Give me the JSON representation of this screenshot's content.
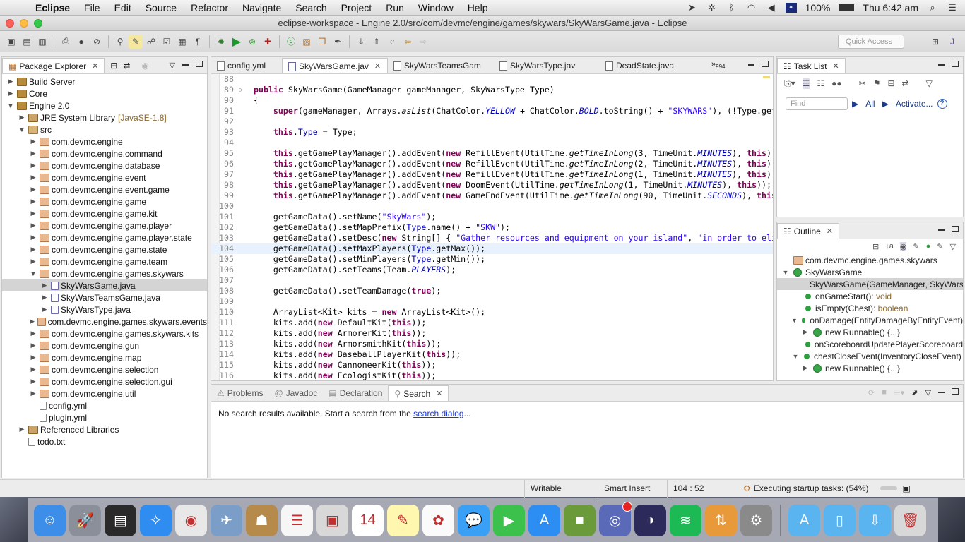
{
  "menubar": {
    "app_name": "Eclipse",
    "items": [
      "File",
      "Edit",
      "Source",
      "Refactor",
      "Navigate",
      "Search",
      "Project",
      "Run",
      "Window",
      "Help"
    ],
    "battery": "100%",
    "clock": "Thu 6:42 am"
  },
  "window": {
    "title": "eclipse-workspace - Engine 2.0/src/com/devmc/engine/games/skywars/SkyWarsGame.java - Eclipse",
    "quick_access_placeholder": "Quick Access"
  },
  "package_explorer": {
    "tab_label": "Package Explorer",
    "rows": [
      {
        "depth": 0,
        "twisty": "▶",
        "icon": "proj",
        "label": "Build Server",
        "deco": ""
      },
      {
        "depth": 0,
        "twisty": "▶",
        "icon": "proj",
        "label": "Core",
        "deco": ""
      },
      {
        "depth": 0,
        "twisty": "▼",
        "icon": "proj",
        "label": "Engine 2.0",
        "deco": ""
      },
      {
        "depth": 1,
        "twisty": "▶",
        "icon": "lib",
        "label": "JRE System Library",
        "deco": "[JavaSE-1.8]"
      },
      {
        "depth": 1,
        "twisty": "▼",
        "icon": "src",
        "label": "src",
        "deco": ""
      },
      {
        "depth": 2,
        "twisty": "▶",
        "icon": "pkg",
        "label": "com.devmc.engine",
        "deco": ""
      },
      {
        "depth": 2,
        "twisty": "▶",
        "icon": "pkg",
        "label": "com.devmc.engine.command",
        "deco": ""
      },
      {
        "depth": 2,
        "twisty": "▶",
        "icon": "pkg",
        "label": "com.devmc.engine.database",
        "deco": ""
      },
      {
        "depth": 2,
        "twisty": "▶",
        "icon": "pkg",
        "label": "com.devmc.engine.event",
        "deco": ""
      },
      {
        "depth": 2,
        "twisty": "▶",
        "icon": "pkg",
        "label": "com.devmc.engine.event.game",
        "deco": ""
      },
      {
        "depth": 2,
        "twisty": "▶",
        "icon": "pkg",
        "label": "com.devmc.engine.game",
        "deco": ""
      },
      {
        "depth": 2,
        "twisty": "▶",
        "icon": "pkg",
        "label": "com.devmc.engine.game.kit",
        "deco": ""
      },
      {
        "depth": 2,
        "twisty": "▶",
        "icon": "pkg",
        "label": "com.devmc.engine.game.player",
        "deco": ""
      },
      {
        "depth": 2,
        "twisty": "▶",
        "icon": "pkg",
        "label": "com.devmc.engine.game.player.state",
        "deco": ""
      },
      {
        "depth": 2,
        "twisty": "▶",
        "icon": "pkg",
        "label": "com.devmc.engine.game.state",
        "deco": ""
      },
      {
        "depth": 2,
        "twisty": "▶",
        "icon": "pkg",
        "label": "com.devmc.engine.game.team",
        "deco": ""
      },
      {
        "depth": 2,
        "twisty": "▼",
        "icon": "pkg",
        "label": "com.devmc.engine.games.skywars",
        "deco": ""
      },
      {
        "depth": 3,
        "twisty": "▶",
        "icon": "java",
        "label": "SkyWarsGame.java",
        "deco": "",
        "selected": true
      },
      {
        "depth": 3,
        "twisty": "▶",
        "icon": "java",
        "label": "SkyWarsTeamsGame.java",
        "deco": ""
      },
      {
        "depth": 3,
        "twisty": "▶",
        "icon": "java",
        "label": "SkyWarsType.java",
        "deco": ""
      },
      {
        "depth": 2,
        "twisty": "▶",
        "icon": "pkg",
        "label": "com.devmc.engine.games.skywars.events",
        "deco": ""
      },
      {
        "depth": 2,
        "twisty": "▶",
        "icon": "pkg",
        "label": "com.devmc.engine.games.skywars.kits",
        "deco": ""
      },
      {
        "depth": 2,
        "twisty": "▶",
        "icon": "pkg",
        "label": "com.devmc.engine.gun",
        "deco": ""
      },
      {
        "depth": 2,
        "twisty": "▶",
        "icon": "pkg",
        "label": "com.devmc.engine.map",
        "deco": ""
      },
      {
        "depth": 2,
        "twisty": "▶",
        "icon": "pkg",
        "label": "com.devmc.engine.selection",
        "deco": ""
      },
      {
        "depth": 2,
        "twisty": "▶",
        "icon": "pkg",
        "label": "com.devmc.engine.selection.gui",
        "deco": ""
      },
      {
        "depth": 2,
        "twisty": "▶",
        "icon": "pkg",
        "label": "com.devmc.engine.util",
        "deco": ""
      },
      {
        "depth": 2,
        "twisty": "",
        "icon": "file",
        "label": "config.yml",
        "deco": ""
      },
      {
        "depth": 2,
        "twisty": "",
        "icon": "file",
        "label": "plugin.yml",
        "deco": ""
      },
      {
        "depth": 1,
        "twisty": "▶",
        "icon": "lib",
        "label": "Referenced Libraries",
        "deco": ""
      },
      {
        "depth": 1,
        "twisty": "",
        "icon": "file",
        "label": "todo.txt",
        "deco": ""
      }
    ]
  },
  "editor": {
    "tabs": [
      {
        "label": "config.yml",
        "active": false,
        "kind": "file"
      },
      {
        "label": "SkyWarsGame.jav",
        "active": true,
        "kind": "java"
      },
      {
        "label": "SkyWarsTeamsGam",
        "active": false,
        "kind": "java"
      },
      {
        "label": "SkyWarsType.jav",
        "active": false,
        "kind": "java"
      },
      {
        "label": "DeadState.java",
        "active": false,
        "kind": "java"
      }
    ],
    "overflow_label": "»",
    "overflow_count": "994",
    "current_line": 104,
    "lines": [
      {
        "n": "88",
        "html": ""
      },
      {
        "n": "89",
        "fold": "⊖",
        "html": "<span class='kw'>public</span> SkyWarsGame(GameManager gameManager, SkyWarsType Type)"
      },
      {
        "n": "90",
        "html": "{"
      },
      {
        "n": "91",
        "html": "    <span class='kw'>super</span>(gameManager, Arrays.<span class='ital'>asList</span>(ChatColor.<span class='stat'>YELLOW</span> + ChatColor.<span class='stat'>BOLD</span>.toString() + <span class='str'>\"SKYWARS\"</span>), (!Type.getN"
      },
      {
        "n": "92",
        "html": ""
      },
      {
        "n": "93",
        "html": "    <span class='kw'>this</span>.<span class='fld'>Type</span> = Type;"
      },
      {
        "n": "94",
        "html": ""
      },
      {
        "n": "95",
        "html": "    <span class='kw'>this</span>.getGamePlayManager().addEvent(<span class='kw'>new</span> RefillEvent(UtilTime.<span class='ital'>getTimeInLong</span>(3, TimeUnit.<span class='stat'>MINUTES</span>), <span class='kw'>this</span>));"
      },
      {
        "n": "96",
        "html": "    <span class='kw'>this</span>.getGamePlayManager().addEvent(<span class='kw'>new</span> RefillEvent(UtilTime.<span class='ital'>getTimeInLong</span>(2, TimeUnit.<span class='stat'>MINUTES</span>), <span class='kw'>this</span>));"
      },
      {
        "n": "97",
        "html": "    <span class='kw'>this</span>.getGamePlayManager().addEvent(<span class='kw'>new</span> RefillEvent(UtilTime.<span class='ital'>getTimeInLong</span>(1, TimeUnit.<span class='stat'>MINUTES</span>), <span class='kw'>this</span>));"
      },
      {
        "n": "98",
        "html": "    <span class='kw'>this</span>.getGamePlayManager().addEvent(<span class='kw'>new</span> DoomEvent(UtilTime.<span class='ital'>getTimeInLong</span>(1, TimeUnit.<span class='stat'>MINUTES</span>), <span class='kw'>this</span>));"
      },
      {
        "n": "99",
        "html": "    <span class='kw'>this</span>.getGamePlayManager().addEvent(<span class='kw'>new</span> GameEndEvent(UtilTime.<span class='ital'>getTimeInLong</span>(90, TimeUnit.<span class='stat'>SECONDS</span>), <span class='kw'>this</span>"
      },
      {
        "n": "100",
        "html": ""
      },
      {
        "n": "101",
        "html": "    getGameData().setName(<span class='str'>\"SkyWars\"</span>);"
      },
      {
        "n": "102",
        "html": "    getGameData().setMapPrefix(<span class='fld'>Type</span>.name() + <span class='str'>\"SKW\"</span>);"
      },
      {
        "n": "103",
        "html": "    getGameData().setDesc(<span class='kw'>new</span> String[] { <span class='str'>\"Gather resources and equipment on your island\"</span>, <span class='str'>\"in order to elim</span>"
      },
      {
        "n": "104",
        "html": "    getGameData().setMaxPlayers(<span class='fld'>Type</span>.getMax());"
      },
      {
        "n": "105",
        "html": "    getGameData().setMinPlayers(<span class='fld'>Type</span>.getMin());"
      },
      {
        "n": "106",
        "html": "    getGameData().setTeams(Team.<span class='stat'>PLAYERS</span>);"
      },
      {
        "n": "107",
        "html": ""
      },
      {
        "n": "108",
        "html": "    getGameData().setTeamDamage(<span class='kw'>true</span>);"
      },
      {
        "n": "109",
        "html": ""
      },
      {
        "n": "110",
        "html": "    ArrayList&lt;Kit&gt; kits = <span class='kw'>new</span> ArrayList&lt;Kit&gt;();"
      },
      {
        "n": "111",
        "html": "    kits.add(<span class='kw'>new</span> DefaultKit(<span class='kw'>this</span>));"
      },
      {
        "n": "112",
        "html": "    kits.add(<span class='kw'>new</span> ArmorerKit(<span class='kw'>this</span>));"
      },
      {
        "n": "113",
        "html": "    kits.add(<span class='kw'>new</span> ArmorsmithKit(<span class='kw'>this</span>));"
      },
      {
        "n": "114",
        "html": "    kits.add(<span class='kw'>new</span> BaseballPlayerKit(<span class='kw'>this</span>));"
      },
      {
        "n": "115",
        "html": "    kits.add(<span class='kw'>new</span> CannoneerKit(<span class='kw'>this</span>));"
      },
      {
        "n": "116",
        "html": "    kits.add(<span class='kw'>new</span> EcologistKit(<span class='kw'>this</span>));"
      }
    ]
  },
  "task_list": {
    "tab_label": "Task List",
    "find_placeholder": "Find",
    "all_label": "All",
    "activate_label": "Activate..."
  },
  "outline": {
    "tab_label": "Outline",
    "rows": [
      {
        "indent": 1,
        "kind": "pkg",
        "label": "com.devmc.engine.games.skywars",
        "ret": ""
      },
      {
        "indent": 0,
        "twisty": "▼",
        "kind": "class",
        "label": "SkyWarsGame",
        "ret": ""
      },
      {
        "indent": 2,
        "kind": "method",
        "label": "SkyWarsGame(GameManager, SkyWarsType)",
        "ret": "",
        "selected": true
      },
      {
        "indent": 2,
        "kind": "method",
        "label": "onGameStart()",
        "ret": " : void"
      },
      {
        "indent": 2,
        "kind": "method",
        "label": "isEmpty(Chest)",
        "ret": " : boolean"
      },
      {
        "indent": 1,
        "twisty": "▼",
        "kind": "method",
        "label": "onDamage(EntityDamageByEntityEvent)",
        "ret": ""
      },
      {
        "indent": 2,
        "twisty": "▶",
        "kind": "class",
        "label": "new Runnable() {...}",
        "ret": ""
      },
      {
        "indent": 2,
        "kind": "method",
        "label": "onScoreboardUpdatePlayerScoreboard",
        "ret": ""
      },
      {
        "indent": 1,
        "twisty": "▼",
        "kind": "method",
        "label": "chestCloseEvent(InventoryCloseEvent)",
        "ret": ""
      },
      {
        "indent": 2,
        "twisty": "▶",
        "kind": "class",
        "label": "new Runnable() {...}",
        "ret": ""
      }
    ]
  },
  "bottom_panel": {
    "tabs": [
      {
        "label": "Problems",
        "active": false
      },
      {
        "label": "Javadoc",
        "active": false
      },
      {
        "label": "Declaration",
        "active": false
      },
      {
        "label": "Search",
        "active": true
      }
    ],
    "message_prefix": "No search results available. Start a search from the ",
    "message_link": "search dialog",
    "message_suffix": "..."
  },
  "status_bar": {
    "writable": "Writable",
    "insert_mode": "Smart Insert",
    "position": "104 : 52",
    "task": "Executing startup tasks: (54%)",
    "progress": 0.54
  },
  "dock": {
    "apps": [
      {
        "name": "finder",
        "color": "#3d8ee8",
        "glyph": "☺"
      },
      {
        "name": "launchpad",
        "color": "#8a8f9a",
        "glyph": "🚀"
      },
      {
        "name": "mission-control",
        "color": "#2a2a2a",
        "glyph": "▤"
      },
      {
        "name": "safari",
        "color": "#2f8cf0",
        "glyph": "✧"
      },
      {
        "name": "chrome",
        "color": "#e8e8e8",
        "glyph": "◉"
      },
      {
        "name": "preview",
        "color": "#7a9ec8",
        "glyph": "✈"
      },
      {
        "name": "contacts",
        "color": "#b58a4a",
        "glyph": "☗"
      },
      {
        "name": "reminders",
        "color": "#f6f6f6",
        "glyph": "☰"
      },
      {
        "name": "photo-booth",
        "color": "#d8d8d8",
        "glyph": "▣"
      },
      {
        "name": "calendar",
        "color": "#ffffff",
        "glyph": "14"
      },
      {
        "name": "notes",
        "color": "#fff7b0",
        "glyph": "✎"
      },
      {
        "name": "photos",
        "color": "#fafafa",
        "glyph": "✿"
      },
      {
        "name": "messages",
        "color": "#3aa0f6",
        "glyph": "💬"
      },
      {
        "name": "facetime",
        "color": "#3cc24c",
        "glyph": "▶"
      },
      {
        "name": "app-store",
        "color": "#2c8ef2",
        "glyph": "A"
      },
      {
        "name": "minecraft",
        "color": "#6a9a3a",
        "glyph": "■"
      },
      {
        "name": "discord",
        "color": "#5a6ab8",
        "glyph": "◎",
        "badge": true
      },
      {
        "name": "eclipse",
        "color": "#2c2a5a",
        "glyph": "◑"
      },
      {
        "name": "spotify",
        "color": "#1db954",
        "glyph": "≋"
      },
      {
        "name": "ftp-client",
        "color": "#e89a3a",
        "glyph": "⇅"
      },
      {
        "name": "system-preferences",
        "color": "#8a8a8a",
        "glyph": "⚙"
      }
    ],
    "folders": [
      {
        "name": "applications-folder",
        "color": "#5ab4f0",
        "glyph": "A"
      },
      {
        "name": "documents-folder",
        "color": "#5ab4f0",
        "glyph": "▯"
      },
      {
        "name": "downloads-folder",
        "color": "#5ab4f0",
        "glyph": "⇩"
      },
      {
        "name": "trash",
        "color": "#d8d8d8",
        "glyph": "🗑"
      }
    ]
  }
}
